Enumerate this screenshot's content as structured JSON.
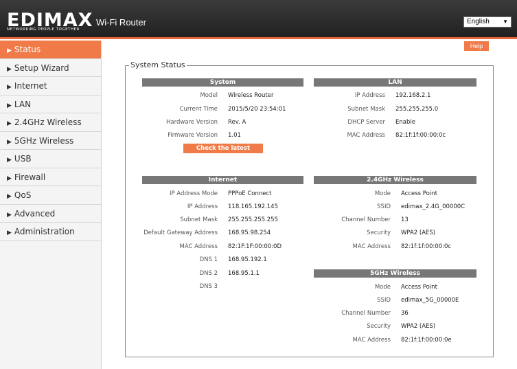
{
  "header": {
    "logo_text": "EDIMAX",
    "logo_tagline": "NETWORKING PEOPLE TOGETHER",
    "product": "Wi-Fi Router",
    "language": "English"
  },
  "sidebar": {
    "items": [
      {
        "label": "Status"
      },
      {
        "label": "Setup Wizard"
      },
      {
        "label": "Internet"
      },
      {
        "label": "LAN"
      },
      {
        "label": "2.4GHz Wireless"
      },
      {
        "label": "5GHz Wireless"
      },
      {
        "label": "USB"
      },
      {
        "label": "Firewall"
      },
      {
        "label": "QoS"
      },
      {
        "label": "Advanced"
      },
      {
        "label": "Administration"
      }
    ]
  },
  "help_label": "Help",
  "legend": "System Status",
  "system": {
    "title": "System",
    "rows": [
      {
        "label": "Model",
        "value": "Wireless Router"
      },
      {
        "label": "Current Time",
        "value": "2015/5/20  23:54:01"
      },
      {
        "label": "Hardware Version",
        "value": "Rev. A"
      },
      {
        "label": "Firmware Version",
        "value": "1.01"
      }
    ],
    "check_button": "Check the latest version"
  },
  "lan": {
    "title": "LAN",
    "rows": [
      {
        "label": "IP Address",
        "value": "192.168.2.1"
      },
      {
        "label": "Subnet Mask",
        "value": "255.255.255.0"
      },
      {
        "label": "DHCP Server",
        "value": "Enable"
      },
      {
        "label": "MAC Address",
        "value": "82:1f:1f:00:00:0c"
      }
    ]
  },
  "internet": {
    "title": "Internet",
    "rows": [
      {
        "label": "IP Address Mode",
        "value": "PPPoE  Connect"
      },
      {
        "label": "IP Address",
        "value": "118.165.192.145"
      },
      {
        "label": "Subnet Mask",
        "value": "255.255.255.255"
      },
      {
        "label": "Default Gateway Address",
        "value": "168.95.98.254"
      },
      {
        "label": "MAC Address",
        "value": "82:1F:1F:00:00:0D"
      },
      {
        "label": "DNS 1",
        "value": "168.95.192.1"
      },
      {
        "label": "DNS 2",
        "value": "168.95.1.1"
      },
      {
        "label": "DNS 3",
        "value": ""
      }
    ]
  },
  "wifi24": {
    "title": "2.4GHz  Wireless",
    "rows": [
      {
        "label": "Mode",
        "value": "Access Point"
      },
      {
        "label": "SSID",
        "value": "edimax_2.4G_00000C"
      },
      {
        "label": "Channel Number",
        "value": "13"
      },
      {
        "label": "Security",
        "value": "WPA2 (AES)"
      },
      {
        "label": "MAC Address",
        "value": "82:1f:1f:00:00:0c"
      }
    ]
  },
  "wifi5": {
    "title": "5GHz  Wireless",
    "rows": [
      {
        "label": "Mode",
        "value": "Access Point"
      },
      {
        "label": "SSID",
        "value": "edimax_5G_00000E"
      },
      {
        "label": "Channel Number",
        "value": "36"
      },
      {
        "label": "Security",
        "value": "WPA2 (AES)"
      },
      {
        "label": "MAC Address",
        "value": "82:1f:1f:00:00:0e"
      }
    ]
  }
}
